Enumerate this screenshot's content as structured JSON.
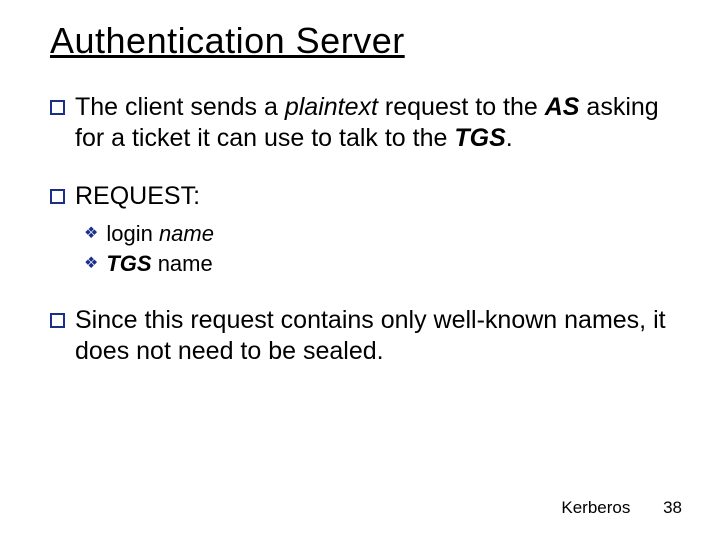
{
  "title": "Authentication Server",
  "bullets": {
    "p1_pre": "The client sends a ",
    "p1_em": "plaintext",
    "p1_mid": " request to the ",
    "p1_as": "AS",
    "p1_mid2": " asking for a ticket it can use to talk to the ",
    "p1_tgs": "TGS",
    "p1_end": ".",
    "p2": "REQUEST:",
    "sub1_pre": "login ",
    "sub1_em": "name",
    "sub2_pre": "TGS",
    "sub2_post": " name",
    "p3": "Since this request contains only well-known names, it does not need to be sealed."
  },
  "footer": {
    "label": "Kerberos",
    "page": "38"
  }
}
